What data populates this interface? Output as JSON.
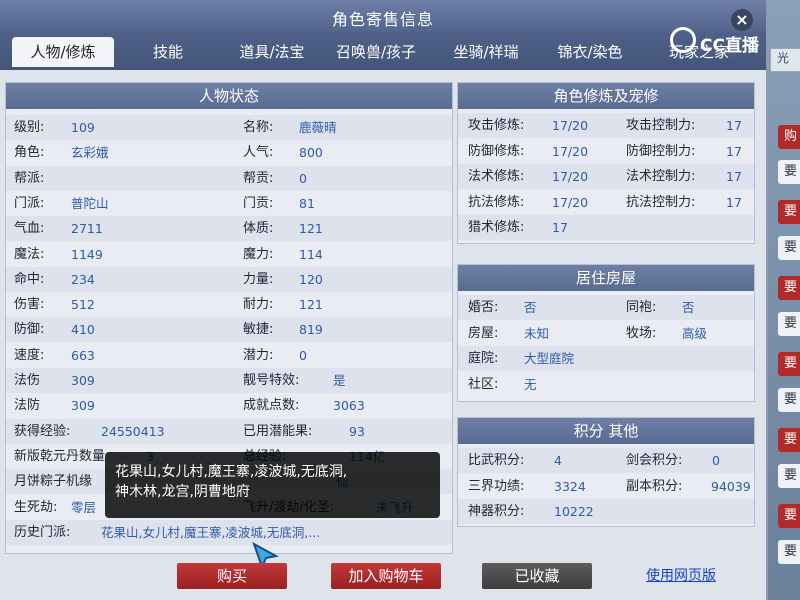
{
  "window_title": "角色寄售信息",
  "close_icon": "close-icon",
  "tabs": [
    "人物/修炼",
    "技能",
    "道具/法宝",
    "召唤兽/孩子",
    "坐骑/祥瑞",
    "锦衣/染色",
    "玩家之家"
  ],
  "status_panel": {
    "title": "人物状态",
    "left": [
      {
        "label": "级别:",
        "value": "109"
      },
      {
        "label": "角色:",
        "value": "玄彩娥"
      },
      {
        "label": "帮派:",
        "value": ""
      },
      {
        "label": "门派:",
        "value": "普陀山"
      },
      {
        "label": "气血:",
        "value": "2711"
      },
      {
        "label": "魔法:",
        "value": "1149"
      },
      {
        "label": "命中:",
        "value": "234"
      },
      {
        "label": "伤害:",
        "value": "512"
      },
      {
        "label": "防御:",
        "value": "410"
      },
      {
        "label": "速度:",
        "value": "663"
      },
      {
        "label": "法伤",
        "value": "309"
      },
      {
        "label": "法防",
        "value": "309"
      },
      {
        "label": "获得经验:",
        "value": "24550413"
      },
      {
        "label": "新版乾元丹数量",
        "value": "3"
      },
      {
        "label": "月饼粽子机缘",
        "value": ""
      },
      {
        "label": "生死劫:",
        "value": "零层"
      }
    ],
    "right": [
      {
        "label": "名称:",
        "value": "鹿薇晴"
      },
      {
        "label": "人气:",
        "value": "800"
      },
      {
        "label": "帮贡:",
        "value": "0"
      },
      {
        "label": "门贡:",
        "value": "81"
      },
      {
        "label": "体质:",
        "value": "121"
      },
      {
        "label": "魔力:",
        "value": "114"
      },
      {
        "label": "力量:",
        "value": "120"
      },
      {
        "label": "耐力:",
        "value": "121"
      },
      {
        "label": "敏捷:",
        "value": "819"
      },
      {
        "label": "潜力:",
        "value": "0"
      },
      {
        "label": "靓号特效:",
        "value": "是"
      },
      {
        "label": "成就点数:",
        "value": "3063"
      },
      {
        "label": "已用潜能果:",
        "value": "93"
      },
      {
        "label": "总经验:",
        "value": "114亿"
      },
      {
        "label": "",
        "value": "仙"
      },
      {
        "label": "飞升/渡劫/化圣:",
        "value": "未飞升"
      }
    ],
    "history_label": "历史门派:",
    "history_value": "花果山,女儿村,魔王寨,凌波城,无底洞,..."
  },
  "cultivation_panel": {
    "title": "角色修炼及宠修",
    "rows": [
      {
        "l1": "攻击修炼:",
        "v1": "17/20",
        "l2": "攻击控制力:",
        "v2": "17"
      },
      {
        "l1": "防御修炼:",
        "v1": "17/20",
        "l2": "防御控制力:",
        "v2": "17"
      },
      {
        "l1": "法术修炼:",
        "v1": "17/20",
        "l2": "法术控制力:",
        "v2": "17"
      },
      {
        "l1": "抗法修炼:",
        "v1": "17/20",
        "l2": "抗法控制力:",
        "v2": "17"
      },
      {
        "l1": "猎术修炼:",
        "v1": "17",
        "l2": "",
        "v2": ""
      }
    ]
  },
  "house_panel": {
    "title": "居住房屋",
    "rows": [
      {
        "l1": "婚否:",
        "v1": "否",
        "l2": "同袍:",
        "v2": "否"
      },
      {
        "l1": "房屋:",
        "v1": "未知",
        "l2": "牧场:",
        "v2": "高级"
      },
      {
        "l1": "庭院:",
        "v1": "大型庭院",
        "l2": "",
        "v2": ""
      },
      {
        "l1": "社区:",
        "v1": "无",
        "l2": "",
        "v2": ""
      }
    ]
  },
  "points_panel": {
    "title": "积分 其他",
    "rows": [
      {
        "l1": "比武积分:",
        "v1": "4",
        "l2": "剑会积分:",
        "v2": "0"
      },
      {
        "l1": "三界功绩:",
        "v1": "3324",
        "l2": "副本积分:",
        "v2": "94039"
      },
      {
        "l1": "神器积分:",
        "v1": "10222",
        "l2": "",
        "v2": ""
      }
    ]
  },
  "tooltip": {
    "line1": "花果山,女儿村,魔王寨,凌波城,无底洞,",
    "line2": "神木林,龙宫,阴曹地府"
  },
  "footer": {
    "buy": "购买",
    "add_cart": "加入购物车",
    "favorited": "已收藏",
    "web_version": "使用网页版"
  },
  "watermark": "CC直播",
  "background": {
    "tab_fragment": "光",
    "buttons": [
      "购",
      "要",
      "要",
      "要",
      "要",
      "要",
      "要",
      "要",
      "要",
      "要",
      "要",
      "要"
    ]
  },
  "colors": {
    "title_bar": "#5a6b92",
    "value_text": "#2f5aa8",
    "buy_button": "#b32a2a",
    "favorited_button": "#4a4a4a",
    "link": "#1742c9"
  }
}
